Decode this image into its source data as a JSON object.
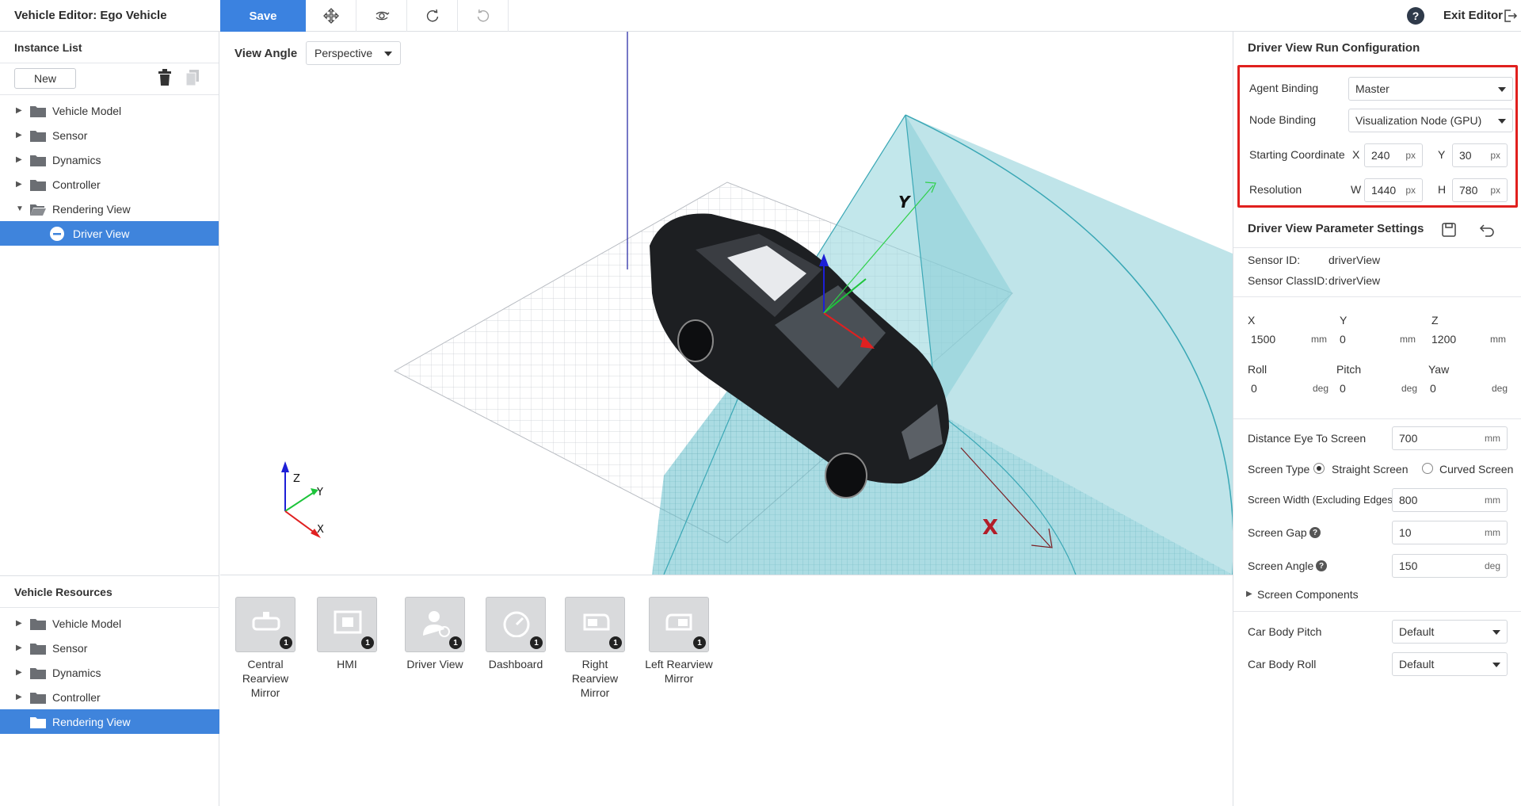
{
  "header": {
    "title": "Vehicle Editor: Ego Vehicle",
    "save_label": "Save",
    "exit_label": "Exit Editor",
    "help_glyph": "?"
  },
  "instance_list": {
    "title": "Instance List",
    "new_label": "New",
    "items": [
      {
        "label": "Vehicle Model"
      },
      {
        "label": "Sensor"
      },
      {
        "label": "Dynamics"
      },
      {
        "label": "Controller"
      },
      {
        "label": "Rendering View"
      },
      {
        "label": "Driver View"
      }
    ]
  },
  "vehicle_resources": {
    "title": "Vehicle Resources",
    "items": [
      {
        "label": "Vehicle Model"
      },
      {
        "label": "Sensor"
      },
      {
        "label": "Dynamics"
      },
      {
        "label": "Controller"
      },
      {
        "label": "Rendering View"
      }
    ]
  },
  "viewport": {
    "view_angle_label": "View Angle",
    "view_angle_value": "Perspective",
    "axis_labels": {
      "x": "X",
      "y": "Y",
      "z": "Z",
      "big_y": "Y"
    }
  },
  "resources": [
    {
      "line1": "Central",
      "line2": "Rearview Mirror",
      "badge": "1",
      "icon": "mirror-icon"
    },
    {
      "line1": "HMI",
      "line2": "",
      "badge": "1",
      "icon": "hmi-icon"
    },
    {
      "line1": "Driver View",
      "line2": "",
      "badge": "1",
      "icon": "driver-icon"
    },
    {
      "line1": "Dashboard",
      "line2": "",
      "badge": "1",
      "icon": "dashboard-icon"
    },
    {
      "line1": "Right Rearview",
      "line2": "Mirror",
      "badge": "1",
      "icon": "right-mirror-icon"
    },
    {
      "line1": "Left Rearview",
      "line2": "Mirror",
      "badge": "1",
      "icon": "left-mirror-icon"
    }
  ],
  "run_config": {
    "title": "Driver View Run Configuration",
    "agent_binding_label": "Agent Binding",
    "agent_binding_value": "Master",
    "node_binding_label": "Node Binding",
    "node_binding_value": "Visualization Node (GPU)",
    "starting_coordinate_label": "Starting Coordinate",
    "x_letter": "X",
    "x_value": "240",
    "x_unit": "px",
    "y_letter": "Y",
    "y_value": "30",
    "y_unit": "px",
    "resolution_label": "Resolution",
    "w_letter": "W",
    "w_value": "1440",
    "w_unit": "px",
    "h_letter": "H",
    "h_value": "780",
    "h_unit": "px"
  },
  "params": {
    "title": "Driver View Parameter Settings",
    "sensor_id_label": "Sensor ID:",
    "sensor_id_value": "driverView",
    "sensor_classid_label": "Sensor ClassID:",
    "sensor_classid_value": "driverView",
    "x_label": "X",
    "x_value": "1500",
    "x_unit": "mm",
    "y_label": "Y",
    "y_value": "0",
    "y_unit": "mm",
    "z_label": "Z",
    "z_value": "1200",
    "z_unit": "mm",
    "roll_label": "Roll",
    "roll_value": "0",
    "roll_unit": "deg",
    "pitch_label": "Pitch",
    "pitch_value": "0",
    "pitch_unit": "deg",
    "yaw_label": "Yaw",
    "yaw_value": "0",
    "yaw_unit": "deg",
    "eye_label": "Distance Eye To Screen",
    "eye_value": "700",
    "eye_unit": "mm",
    "screen_type_label": "Screen Type",
    "straight_label": "Straight Screen",
    "curved_label": "Curved Screen",
    "width_label": "Screen Width (Excluding Edges)",
    "width_value": "800",
    "width_unit": "mm",
    "gap_label": "Screen Gap",
    "gap_value": "10",
    "gap_unit": "mm",
    "angle_label": "Screen Angle",
    "angle_value": "150",
    "angle_unit": "deg",
    "components_label": "Screen Components",
    "pitch_body_label": "Car Body Pitch",
    "pitch_body_value": "Default",
    "roll_body_label": "Car Body Roll",
    "roll_body_value": "Default",
    "info_glyph": "?"
  },
  "colors": {
    "accent": "#3b82e0",
    "selected_row": "#3f84dc",
    "highlight_border": "#e0201e",
    "frustum": "#5fc3cf"
  }
}
